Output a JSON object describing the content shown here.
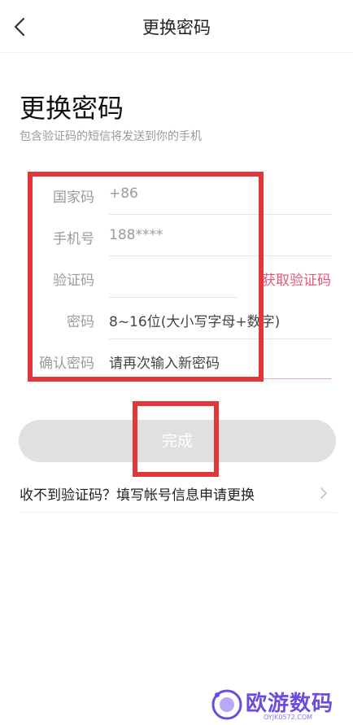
{
  "nav": {
    "title": "更换密码",
    "back_icon": "chevron-left-icon"
  },
  "header": {
    "title": "更换密码",
    "subtitle": "包含验证码的短信将发送到你的手机"
  },
  "form": {
    "country": {
      "label": "国家码",
      "value": "+86"
    },
    "phone": {
      "label": "手机号",
      "value": "188****"
    },
    "code": {
      "label": "验证码",
      "value": "",
      "action": "获取验证码"
    },
    "password": {
      "label": "密码",
      "placeholder": "8~16位(大小写字母+数字)"
    },
    "confirm": {
      "label": "确认密码",
      "placeholder": "请再次输入新密码"
    }
  },
  "done_button": "完成",
  "help": {
    "text": "收不到验证码？填写帐号信息申请更换",
    "icon": "chevron-right-icon"
  },
  "watermark": {
    "text": "欧游数码",
    "sub": "OYJK0572.COM"
  },
  "colors": {
    "accent": "#e8557a",
    "annotation": "#e0383a",
    "watermark": "#6c4ce0"
  }
}
